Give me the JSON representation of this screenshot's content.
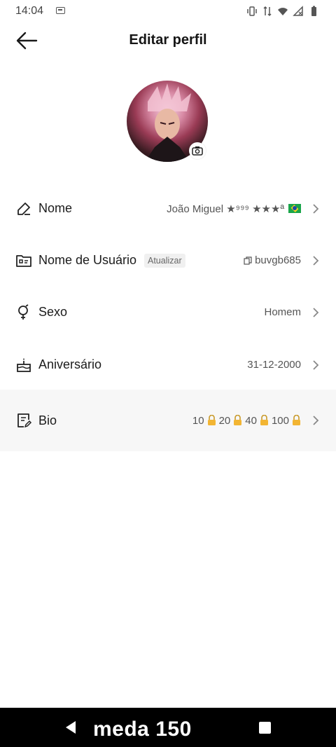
{
  "status_bar": {
    "time": "14:04"
  },
  "header": {
    "title": "Editar perfil"
  },
  "rows": [
    {
      "label": "Nome",
      "value": "João Miguel ★⁹⁹⁹ ★★★ª"
    },
    {
      "label": "Nome de Usuário",
      "badge": "Atualizar",
      "value": "buvgb685"
    },
    {
      "label": "Sexo",
      "value": "Homem"
    },
    {
      "label": "Aniversário",
      "value": "31-12-2000"
    },
    {
      "label": "Bio",
      "values": [
        "10",
        "20",
        "40",
        "100"
      ]
    }
  ],
  "nav_bar": {
    "overlay_text": "meda 150"
  },
  "colors": {
    "background": "#ffffff",
    "highlight_row": "#f7f7f7",
    "nav_bar": "#000000",
    "flag_green": "#1aa54a",
    "flag_yellow": "#ffd21f",
    "lock_gold": "#f2b533"
  }
}
